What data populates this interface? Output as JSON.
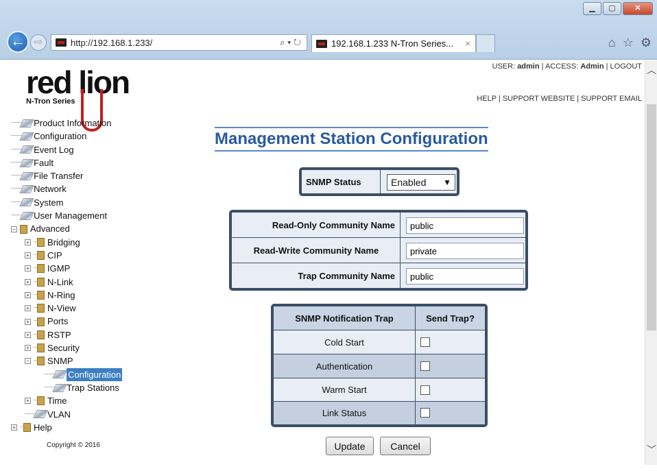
{
  "browser": {
    "url": "http://192.168.1.233/",
    "search_icon": "search-icon",
    "tab_title": "192.168.1.233 N-Tron Series...",
    "tab_close": "×"
  },
  "header": {
    "user_label": "USER:",
    "user": "admin",
    "access_label": "ACCESS:",
    "access": "Admin",
    "logout": "LOGOUT",
    "help": "HELP",
    "support_website": "SUPPORT WEBSITE",
    "support_email": "SUPPORT EMAIL",
    "separator": "|"
  },
  "logo": {
    "word": "red lion",
    "sub": "N-Tron Series",
    "badge": "red lion"
  },
  "sidebar": {
    "items": [
      {
        "label": "Product Information"
      },
      {
        "label": "Configuration"
      },
      {
        "label": "Event Log"
      },
      {
        "label": "Fault"
      },
      {
        "label": "File Transfer"
      },
      {
        "label": "Network"
      },
      {
        "label": "System"
      },
      {
        "label": "User Management"
      },
      {
        "label": "Advanced"
      },
      {
        "label": "Bridging"
      },
      {
        "label": "CIP"
      },
      {
        "label": "IGMP"
      },
      {
        "label": "N-Link"
      },
      {
        "label": "N-Ring"
      },
      {
        "label": "N-View"
      },
      {
        "label": "Ports"
      },
      {
        "label": "RSTP"
      },
      {
        "label": "Security"
      },
      {
        "label": "SNMP"
      },
      {
        "label": "Configuration"
      },
      {
        "label": "Trap Stations"
      },
      {
        "label": "Time"
      },
      {
        "label": "VLAN"
      },
      {
        "label": "Help"
      }
    ],
    "copyright": "Copyright © 2016"
  },
  "main": {
    "title": "Management Station Configuration",
    "snmp_status_label": "SNMP Status",
    "snmp_status_value": "Enabled",
    "community": [
      {
        "label": "Read-Only Community Name",
        "value": "public"
      },
      {
        "label": "Read-Write Community Name",
        "value": "private"
      },
      {
        "label": "Trap Community Name",
        "value": "public"
      }
    ],
    "trap_header": [
      "SNMP Notification Trap",
      "Send Trap?"
    ],
    "traps": [
      {
        "label": "Cold Start",
        "checked": false
      },
      {
        "label": "Authentication",
        "checked": false
      },
      {
        "label": "Warm Start",
        "checked": false
      },
      {
        "label": "Link Status",
        "checked": false
      }
    ],
    "update_label": "Update",
    "cancel_label": "Cancel"
  }
}
